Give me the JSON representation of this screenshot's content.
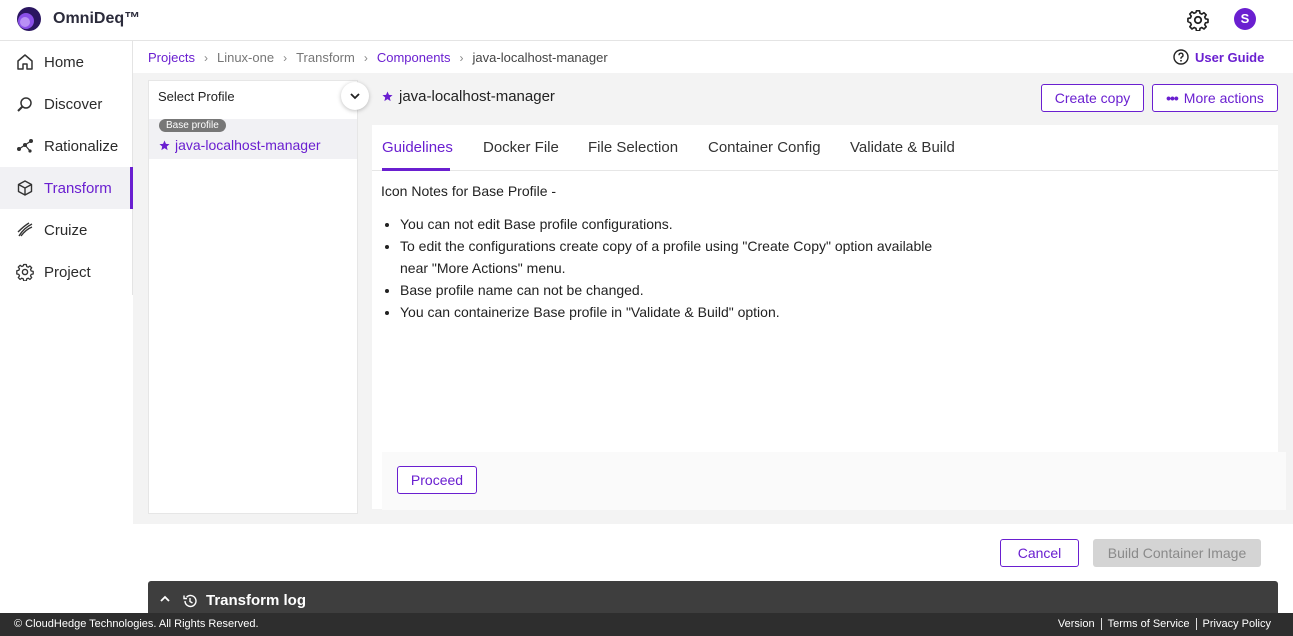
{
  "app": {
    "title": "OmniDeq™",
    "avatar_initial": "S"
  },
  "sidebar": {
    "items": [
      {
        "label": "Home",
        "icon": "home-icon"
      },
      {
        "label": "Discover",
        "icon": "discover-icon"
      },
      {
        "label": "Rationalize",
        "icon": "rationalize-icon"
      },
      {
        "label": "Transform",
        "icon": "transform-icon",
        "active": true
      },
      {
        "label": "Cruize",
        "icon": "cruize-icon"
      },
      {
        "label": "Project",
        "icon": "project-gear-icon"
      }
    ]
  },
  "breadcrumb": {
    "projects": "Projects",
    "project": "Linux-one",
    "stage": "Transform",
    "section": "Components",
    "current": "java-localhost-manager"
  },
  "user_guide": "User Guide",
  "profile_panel": {
    "select_label": "Select Profile",
    "badge": "Base profile",
    "profile_name": "java-localhost-manager"
  },
  "header": {
    "profile_name": "java-localhost-manager",
    "create_copy": "Create copy",
    "more_actions": "More actions"
  },
  "tabs": [
    "Guidelines",
    "Docker File",
    "File Selection",
    "Container Config",
    "Validate & Build"
  ],
  "active_tab": "Guidelines",
  "notes": {
    "title": "Icon Notes for Base Profile -",
    "items": [
      "You can not edit Base profile configurations.",
      "To edit the configurations create copy of a profile using \"Create Copy\" option available near \"More Actions\" menu.",
      "Base profile name can not be changed.",
      "You can containerize Base profile in \"Validate & Build\" option."
    ]
  },
  "buttons": {
    "proceed": "Proceed",
    "cancel": "Cancel",
    "build": "Build Container Image"
  },
  "log": {
    "label": "Transform log"
  },
  "footer": {
    "copyright": "© CloudHedge Technologies. All Rights Reserved.",
    "version": "Version",
    "terms": "Terms of Service",
    "privacy": "Privacy Policy"
  },
  "colors": {
    "accent": "#6a1fd0",
    "log_bar": "#3e3e3e",
    "footer": "#2e2e2e"
  }
}
